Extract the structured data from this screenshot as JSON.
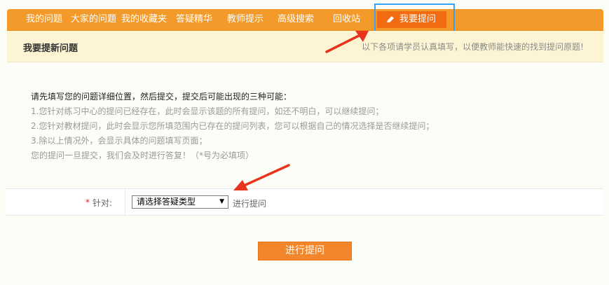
{
  "nav": {
    "items": [
      "我的问题",
      "大家的问题",
      "我的收藏夹",
      "答疑精华",
      "教师提示",
      "高级搜索",
      "回收站"
    ],
    "active_label": "我要提问"
  },
  "subheader": {
    "title": "我要提新问题",
    "hint": "以下各项请学员认真填写，以便教师能快速的找到提问原题!"
  },
  "instructions": {
    "lead": "请先填写您的问题详细位置，然后提交，提交后可能出现的三种可能：",
    "lines": [
      "1.您针对练习中心的提问已经存在，此时会显示该题的所有提问，如还不明白，可以继续提问；",
      "2.您针对教材提问，此时会显示您所填范围内已存在的提问列表，您可以根据自己的情况选择是否继续提问；",
      "3.除以上情况外，会显示具体的问题填写页面；",
      "您的提问一旦提交，我们会及时进行答复！（*号为必填项）"
    ]
  },
  "form": {
    "required_mark": "*",
    "label": "针对:",
    "select_value": "请选择答疑类型",
    "after_text": "进行提问"
  },
  "submit_label": "进行提问",
  "colors": {
    "nav_bg": "#f39a2a",
    "active_tab_bg": "#f26b10",
    "highlight_border": "#35a2f2",
    "annotation_arrow": "#e8341c",
    "subheader_bg": "#fdf4d4"
  }
}
